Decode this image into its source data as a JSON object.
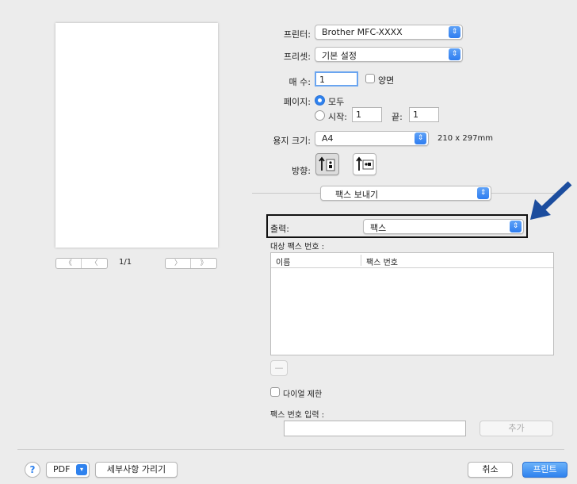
{
  "printer": {
    "label": "프린터:",
    "value": "Brother MFC-XXXX"
  },
  "preset": {
    "label": "프리셋:",
    "value": "기본 설정"
  },
  "copies": {
    "label": "매 수:",
    "value": "1",
    "duplex_label": "양면"
  },
  "pages": {
    "label": "페이지:",
    "all_label": "모두",
    "from_label": "시작:",
    "from_value": "1",
    "to_label": "끝:",
    "to_value": "1"
  },
  "paper": {
    "label": "용지 크기:",
    "value": "A4",
    "dimensions": "210 x 297mm"
  },
  "orientation": {
    "label": "방향:"
  },
  "preview": {
    "page_indicator": "1/1",
    "first_glyph": "《",
    "prev_glyph": "〈",
    "next_glyph": "〉",
    "last_glyph": "》"
  },
  "section_menu": {
    "value": "팩스 보내기"
  },
  "output": {
    "label": "출력:",
    "value": "팩스"
  },
  "destination": {
    "label": "대상 팩스 번호 :",
    "columns": [
      "이름",
      "팩스 번호"
    ],
    "remove_label": "—"
  },
  "dial_restriction": {
    "label": "다이얼 제한"
  },
  "fax_input": {
    "label": "팩스 번호 입력 :",
    "value": "",
    "add_label": "추가"
  },
  "footer": {
    "help_label": "?",
    "pdf_label": "PDF",
    "hide_details_label": "세부사항 가리기",
    "cancel_label": "취소",
    "print_label": "프린트"
  },
  "colors": {
    "accent": "#2f82ee",
    "arrow": "#1c4d9e"
  }
}
